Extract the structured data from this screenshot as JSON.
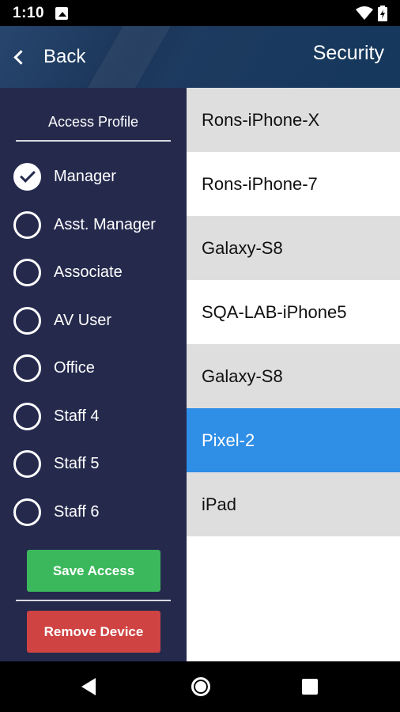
{
  "status_bar": {
    "time": "1:10"
  },
  "app_bar": {
    "back_label": "Back",
    "title": "Security"
  },
  "access_profile": {
    "header": "Access Profile",
    "items": [
      {
        "label": "Manager",
        "checked": true
      },
      {
        "label": "Asst. Manager",
        "checked": false
      },
      {
        "label": "Associate",
        "checked": false
      },
      {
        "label": "AV User",
        "checked": false
      },
      {
        "label": "Office",
        "checked": false
      },
      {
        "label": "Staff 4",
        "checked": false
      },
      {
        "label": "Staff 5",
        "checked": false
      },
      {
        "label": "Staff 6",
        "checked": false
      }
    ],
    "save_label": "Save Access",
    "remove_label": "Remove Device"
  },
  "devices": [
    {
      "name": "Rons-iPhone-X",
      "selected": false
    },
    {
      "name": "Rons-iPhone-7",
      "selected": false
    },
    {
      "name": "Galaxy-S8",
      "selected": false
    },
    {
      "name": "SQA-LAB-iPhone5",
      "selected": false
    },
    {
      "name": "Galaxy-S8",
      "selected": false
    },
    {
      "name": "Pixel-2",
      "selected": true
    },
    {
      "name": "iPad",
      "selected": false
    }
  ],
  "colors": {
    "panel_bg": "#252a4d",
    "save_green": "#3cb85c",
    "remove_red": "#cf4343",
    "selected_blue": "#2f8ee6",
    "row_gray": "#dedede"
  }
}
